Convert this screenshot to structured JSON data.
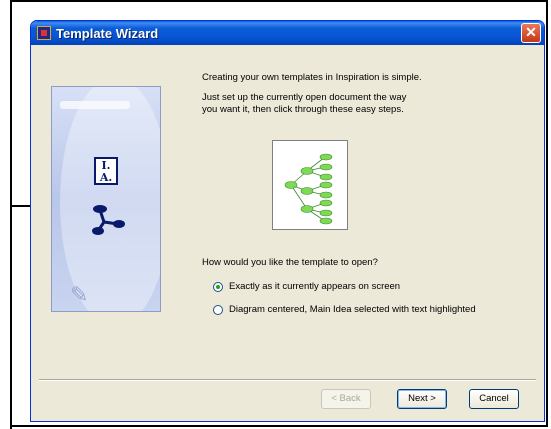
{
  "window": {
    "title": "Template Wizard",
    "close_glyph": "✕"
  },
  "content": {
    "intro": "Creating your own templates in Inspiration is simple.",
    "instructions_line1": "Just set up the currently open document the way",
    "instructions_line2": "you want it, then click through these easy steps.",
    "question": "How would you like the template to open?"
  },
  "options": [
    {
      "label": "Exactly as it currently appears on screen",
      "selected": true
    },
    {
      "label": "Diagram centered, Main Idea selected with text highlighted",
      "selected": false
    }
  ],
  "side_art": {
    "badge_line1": "I.",
    "badge_line2": "A."
  },
  "buttons": {
    "back": "< Back",
    "next": "Next >",
    "cancel": "Cancel"
  },
  "colors": {
    "titlebar": "#0654d3",
    "dialog_bg": "#ece9d8",
    "diagram_node": "#7ed957"
  },
  "icons": {
    "title": "inspiration-app-icon",
    "close": "close-icon",
    "map": "concept-map-icon"
  }
}
